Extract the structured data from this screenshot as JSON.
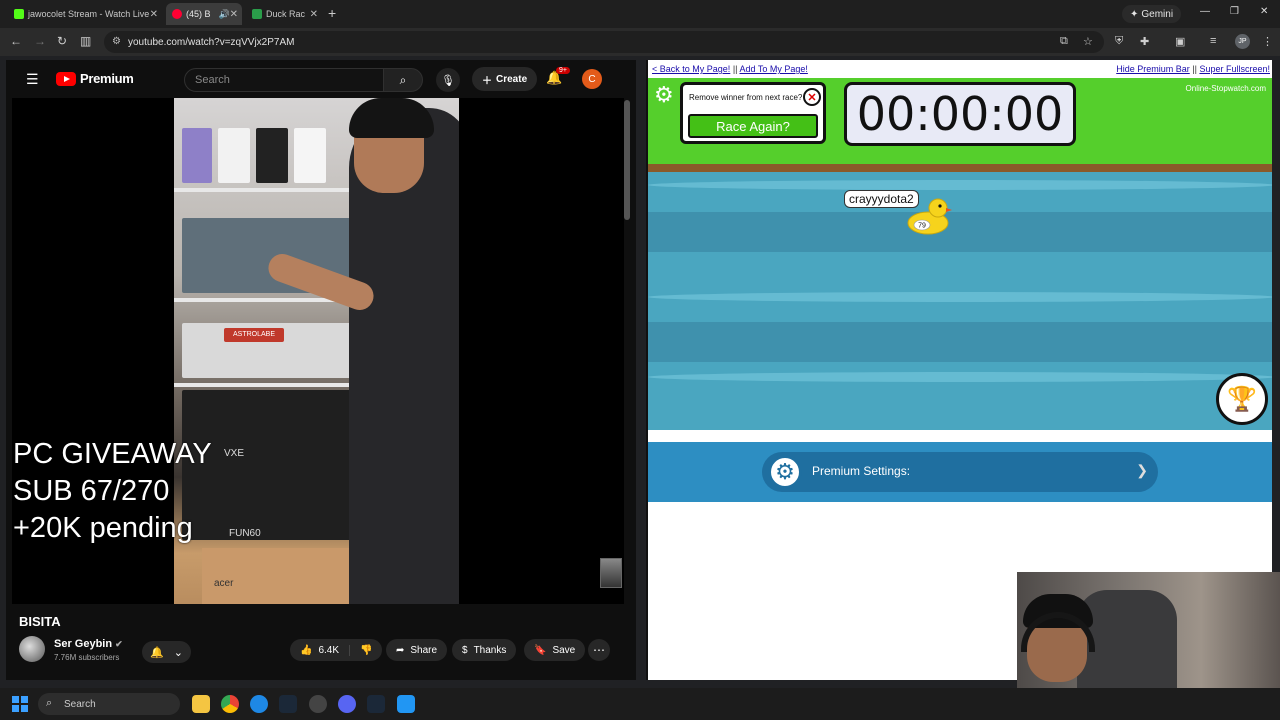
{
  "browser": {
    "tabs": [
      {
        "title": "jawocolet Stream - Watch Live",
        "color": "#53fc18"
      },
      {
        "title": "(45) B",
        "color": "#ff0033"
      },
      {
        "title": "Duck Rac",
        "color": "#2a9d4a"
      }
    ],
    "gemini_label": "Gemini",
    "url": "youtube.com/watch?v=zqVVjx2P7AM",
    "profile_initials": "JP"
  },
  "youtube": {
    "logo_text": "Premium",
    "search_placeholder": "Search",
    "create_label": "Create",
    "notif_badge": "9+",
    "avatar_letter": "C",
    "overlay_lines": [
      "PC GIVEAWAY",
      "SUB 67/270",
      "+20K pending"
    ],
    "video_title": "BISITA",
    "channel_name": "Ser Geybin",
    "subscribers": "7.76M subscribers",
    "likes": "6.4K",
    "share_label": "Share",
    "thanks_label": "Thanks",
    "save_label": "Save",
    "video_box_texts": [
      "ASTROLABE",
      "VXE",
      "FUN60",
      "acer"
    ]
  },
  "race": {
    "back_link": "< Back to My Page!",
    "add_link": "Add To My Page!",
    "hide_link": "Hide Premium Bar",
    "fullscreen_link": "Super Fullscreen!",
    "remove_winner_text": "Remove winner from next race?",
    "race_again_label": "Race Again?",
    "timer": "00:00:00",
    "brand": "Online-Stopwatch.com",
    "duck_name": "crayyydota2",
    "duck_number": "79",
    "premium_settings_label": "Premium Settings:"
  },
  "taskbar": {
    "search_placeholder": "Search"
  }
}
